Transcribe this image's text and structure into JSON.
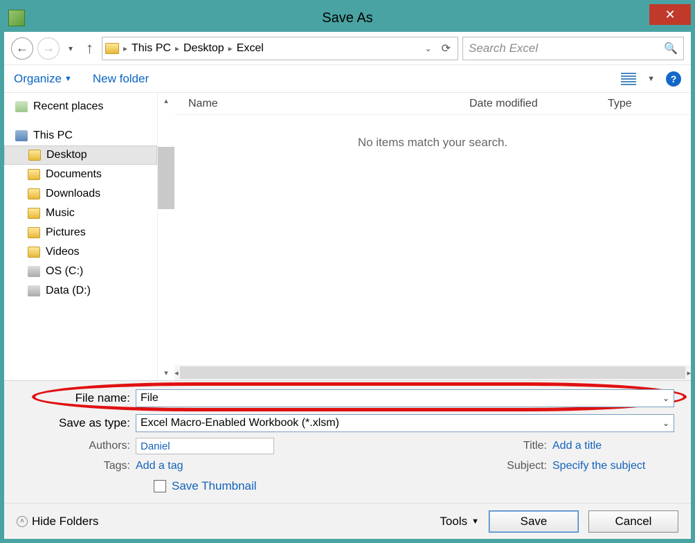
{
  "titlebar": {
    "title": "Save As"
  },
  "nav": {
    "breadcrumbs": [
      "This PC",
      "Desktop",
      "Excel"
    ],
    "search_placeholder": "Search Excel"
  },
  "toolbar": {
    "organize": "Organize",
    "new_folder": "New folder"
  },
  "tree": {
    "recent": "Recent places",
    "this_pc": "This PC",
    "items": [
      {
        "label": "Desktop",
        "icon": "folder",
        "selected": true
      },
      {
        "label": "Documents",
        "icon": "folder"
      },
      {
        "label": "Downloads",
        "icon": "folder"
      },
      {
        "label": "Music",
        "icon": "folder"
      },
      {
        "label": "Pictures",
        "icon": "folder"
      },
      {
        "label": "Videos",
        "icon": "folder"
      },
      {
        "label": "OS (C:)",
        "icon": "drive"
      },
      {
        "label": "Data (D:)",
        "icon": "drive"
      }
    ]
  },
  "list": {
    "cols": {
      "name": "Name",
      "date": "Date modified",
      "type": "Type"
    },
    "empty": "No items match your search."
  },
  "form": {
    "file_name_label": "File name:",
    "file_name_value": "File",
    "save_type_label": "Save as type:",
    "save_type_value": "Excel Macro-Enabled Workbook (*.xlsm)",
    "authors_label": "Authors:",
    "authors_value": "Daniel",
    "tags_label": "Tags:",
    "tags_link": "Add a tag",
    "title_label": "Title:",
    "title_link": "Add a title",
    "subject_label": "Subject:",
    "subject_link": "Specify the subject",
    "save_thumbnail": "Save Thumbnail"
  },
  "footer": {
    "hide_folders": "Hide Folders",
    "tools": "Tools",
    "save": "Save",
    "cancel": "Cancel"
  }
}
